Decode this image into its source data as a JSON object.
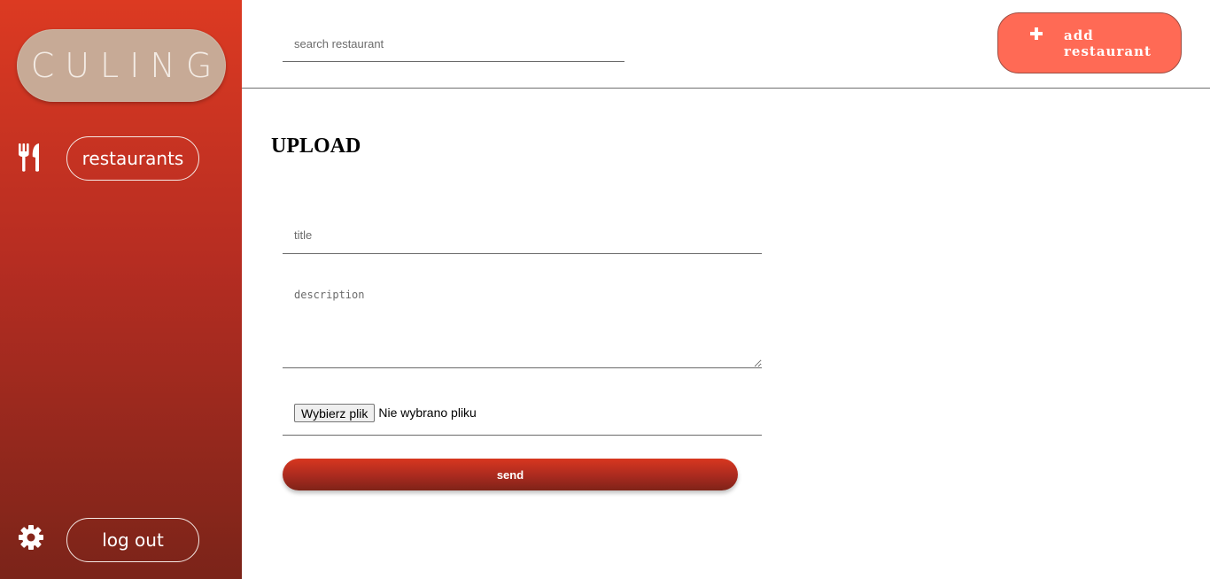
{
  "sidebar": {
    "logo_text": "CULING",
    "nav_items": [
      {
        "icon": "utensils-icon",
        "label": "restaurants"
      }
    ],
    "bottom": {
      "icon": "gear-icon",
      "label": "log out"
    }
  },
  "topbar": {
    "search_placeholder": "search restaurant",
    "add_button_icon": "plus-icon",
    "add_button_label": "add restaurant"
  },
  "main": {
    "heading": "UPLOAD",
    "form": {
      "title_placeholder": "title",
      "description_placeholder": "description",
      "file_button_label": "Wybierz plik",
      "file_status": "Nie wybrano pliku",
      "submit_label": "send"
    }
  },
  "colors": {
    "sidebar_top": "#dc3a22",
    "sidebar_bottom": "#7b2419",
    "logo_bg": "#c7aa96",
    "add_button_bg": "#ff6a55",
    "send_button": "#a92a1f"
  }
}
